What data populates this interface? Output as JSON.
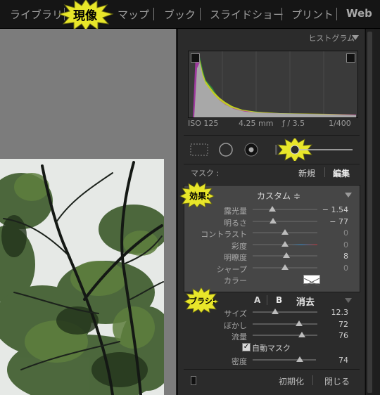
{
  "modules": [
    {
      "label": "ライブラリ"
    },
    {
      "label": "現像"
    },
    {
      "label": "マップ"
    },
    {
      "label": "ブック"
    },
    {
      "label": "スライドショー"
    },
    {
      "label": "プリント"
    },
    {
      "label": "Web"
    }
  ],
  "histogram": {
    "title": "ヒストグラム",
    "iso": "ISO 125",
    "focal": "4.25 mm",
    "aperture": "ƒ / 3.5",
    "shutter": "1/400"
  },
  "mask": {
    "label": "マスク :",
    "new_label": "新規",
    "edit_label": "編集"
  },
  "effect": {
    "label": "効果:",
    "preset": "カスタム ≑",
    "rows": [
      {
        "label": "露光量",
        "value": "− 1.54",
        "level": 0.3
      },
      {
        "label": "明るさ",
        "value": "− 77",
        "level": 0.31
      },
      {
        "label": "コントラスト",
        "value": "0",
        "level": 0.5
      },
      {
        "label": "彩度",
        "value": "0",
        "level": 0.5
      },
      {
        "label": "明瞭度",
        "value": "8",
        "level": 0.52
      },
      {
        "label": "シャープ",
        "value": "0",
        "level": 0.5
      }
    ],
    "color_label": "カラー"
  },
  "brush": {
    "label": "ブラシ:",
    "tab_a": "A",
    "tab_b": "B",
    "erase": "消去",
    "rows": [
      {
        "label": "サイズ",
        "value": "12.3",
        "level": 0.35
      },
      {
        "label": "ぼかし",
        "value": "72",
        "level": 0.72
      },
      {
        "label": "流量",
        "value": "76",
        "level": 0.76
      }
    ],
    "automask_label": "自動マスク",
    "automask_checked": true,
    "density_label": "密度",
    "density_value": "74",
    "density_level": 0.74
  },
  "footer": {
    "reset_label": "初期化",
    "close_label": "閉じる"
  }
}
